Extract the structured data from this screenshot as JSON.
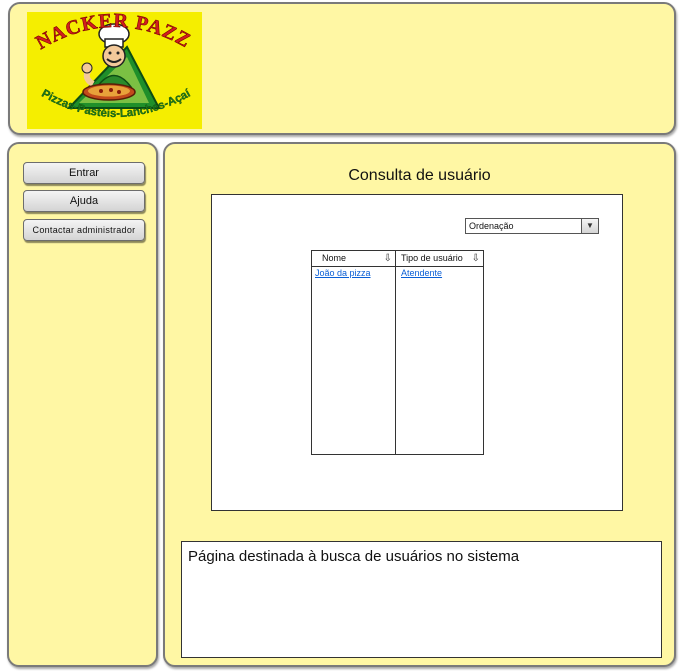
{
  "logo": {
    "brand": "SNACKER PAZZA",
    "tagline": "Pizzas • Pastéis • Lanches • Açaí",
    "icon": "chef-pizza-logo"
  },
  "sidebar": {
    "items": [
      {
        "label": "Entrar"
      },
      {
        "label": "Ajuda"
      },
      {
        "label": "Contactar administrador"
      }
    ]
  },
  "main": {
    "title": "Consulta de usuário",
    "sort": {
      "selected": "Ordenação",
      "icon": "chevron-down-icon"
    },
    "table": {
      "columns": [
        {
          "label": "Nome",
          "icon": "sort-down-icon"
        },
        {
          "label": "Tipo de usuário",
          "icon": "sort-down-icon"
        }
      ],
      "rows": [
        {
          "name": "João da pizza",
          "type": "Atendente"
        }
      ]
    },
    "description": "Página destinada à busca de usuários no sistema"
  },
  "colors": {
    "panel_bg": "#fff7a4",
    "logo_bg": "#f5ee00",
    "link": "#0a5fd6"
  }
}
